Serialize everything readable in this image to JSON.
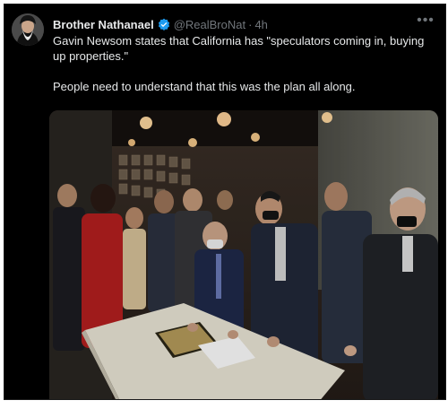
{
  "author": {
    "display_name": "Brother Nathanael",
    "handle": "@RealBroNat",
    "separator": "·",
    "timestamp": "4h",
    "verified_icon": "verified-badge-icon",
    "avatar_icon": "avatar-image"
  },
  "menu": {
    "more_label": "•••"
  },
  "tweet": {
    "paragraph_1": "Gavin Newsom states that  California has \"speculators coming in, buying up properties.\"",
    "paragraph_2": "People need to understand that this was the plan all along."
  },
  "colors": {
    "background": "#000000",
    "text_primary": "#e7e9ea",
    "text_secondary": "#71767b",
    "verified_blue": "#1d9bf0"
  }
}
